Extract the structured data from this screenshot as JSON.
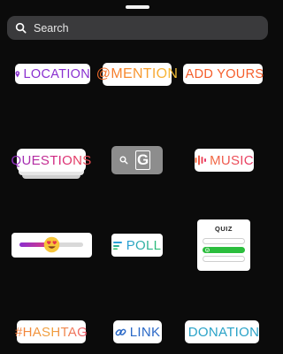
{
  "search": {
    "placeholder": "Search"
  },
  "stickers": {
    "location": "LOCATION",
    "mention": "@MENTION",
    "add_yours": "ADD YOURS",
    "questions": "QUESTIONS",
    "search_sticker": "G",
    "music": "MUSIC",
    "emoji_slider": {
      "emoji": "heart-eyes-emoji",
      "level": 0.5
    },
    "poll": "POLL",
    "quiz": {
      "title": "QUIZ",
      "options": 3,
      "correct_option": 2
    },
    "hashtag": "#HASHTAG",
    "link": "LINK",
    "donation": "DONATION"
  },
  "colors": {
    "background": "#0b0b0b",
    "search_bg": "#3a3a3c",
    "location": "#8a2fd0",
    "add_yours": "#f55d2a",
    "link": "#2b69c7",
    "donation": "#2aa3c8",
    "quiz_correct": "#2bbd3d"
  },
  "icons": [
    "search-icon",
    "location-pin-icon",
    "camera-icon",
    "music-bars-icon",
    "poll-icon",
    "link-icon",
    "heart-icon",
    "check-icon"
  ]
}
